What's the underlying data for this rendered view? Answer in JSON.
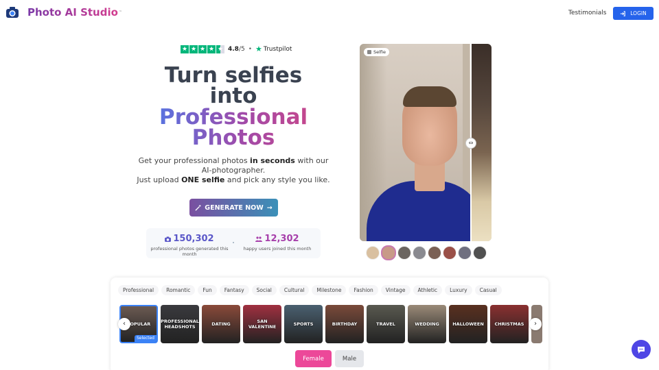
{
  "header": {
    "brand": "Photo AI Studio",
    "trademark": "™",
    "nav_testimonials": "Testimonials",
    "login_label": "LOGIN"
  },
  "trust": {
    "rating": "4.8",
    "rating_denominator": "/5",
    "separator": "•",
    "provider": "Trustpilot"
  },
  "hero": {
    "line1": "Turn selfies",
    "line2": "into",
    "line3": "Professional",
    "line4": "Photos",
    "sub_a": "Get your professional photos ",
    "sub_a_bold": "in seconds",
    "sub_a_end": " with our",
    "sub_b": "AI-photographer.",
    "sub_c": "Just upload ",
    "sub_c_bold": "ONE selfie",
    "sub_c_end": " and pick any style you like.",
    "cta_label": "GENERATE NOW"
  },
  "stats": {
    "photos_value": "150,302",
    "photos_label": "professional photos generated this month",
    "users_value": "12,302",
    "users_label": "happy users joined this month"
  },
  "preview": {
    "tag": "Selfie"
  },
  "categories": [
    "Professional",
    "Romantic",
    "Fun",
    "Fantasy",
    "Social",
    "Cultural",
    "Milestone",
    "Fashion",
    "Vintage",
    "Athletic",
    "Luxury",
    "Casual"
  ],
  "styles": [
    {
      "label": "POPULAR",
      "selected": true,
      "color": "#6b5a52"
    },
    {
      "label": "PROFESSIONAL HEADSHOTS",
      "color": "#3a3a3e"
    },
    {
      "label": "DATING",
      "color": "#8a4a3a"
    },
    {
      "label": "SAN VALENTINE",
      "color": "#a03040"
    },
    {
      "label": "SPORTS",
      "color": "#4a6070"
    },
    {
      "label": "BIRTHDAY",
      "color": "#7a4a3a"
    },
    {
      "label": "TRAVEL",
      "color": "#5a5a50"
    },
    {
      "label": "WEDDING",
      "color": "#9a8a78"
    },
    {
      "label": "HALLOWEEN",
      "color": "#5a3020"
    },
    {
      "label": "CHRISTMAS",
      "color": "#8a3030"
    }
  ],
  "selected_tag": "Selected",
  "gender": {
    "female": "Female",
    "male": "Male",
    "selected": "Female"
  },
  "colors": {
    "accent": "#2563eb",
    "female_button": "#ec4899",
    "chat_button": "#4f46e5"
  },
  "icons": [
    "camera-logo-icon",
    "login-icon",
    "trustpilot-star-icon",
    "magic-wand-icon",
    "arrow-right-icon",
    "camera-icon",
    "users-icon",
    "chevron-left-icon",
    "chevron-right-icon",
    "chat-icon"
  ]
}
